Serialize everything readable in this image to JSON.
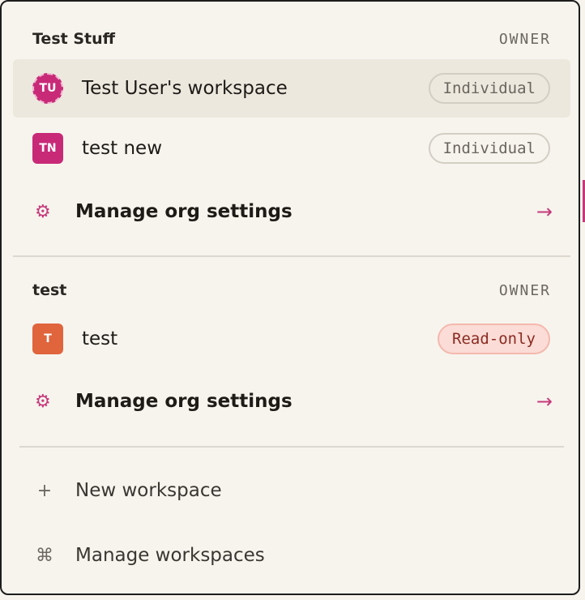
{
  "orgs": [
    {
      "name": "Test Stuff",
      "role": "OWNER",
      "workspaces": [
        {
          "initials": "TU",
          "name": "Test User's workspace",
          "badge": "Individual"
        },
        {
          "initials": "TN",
          "name": "test new",
          "badge": "Individual"
        }
      ],
      "settings": {
        "label": "Manage org settings",
        "icon": "gear-icon",
        "arrow": "→"
      }
    },
    {
      "name": "test",
      "role": "OWNER",
      "workspaces": [
        {
          "initials": "T",
          "name": "test",
          "badge": "Read-only"
        }
      ],
      "settings": {
        "label": "Manage org settings",
        "icon": "gear-icon",
        "arrow": "→"
      }
    }
  ],
  "footer": {
    "new_workspace": {
      "label": "New workspace",
      "icon": "+"
    },
    "manage_workspaces": {
      "label": "Manage workspaces",
      "icon": "⌘"
    }
  },
  "colors": {
    "accent": "#c6397a",
    "avatar_pink": "#c82a78",
    "avatar_orange": "#e0643c",
    "readonly_bg": "#fbdcd6"
  }
}
